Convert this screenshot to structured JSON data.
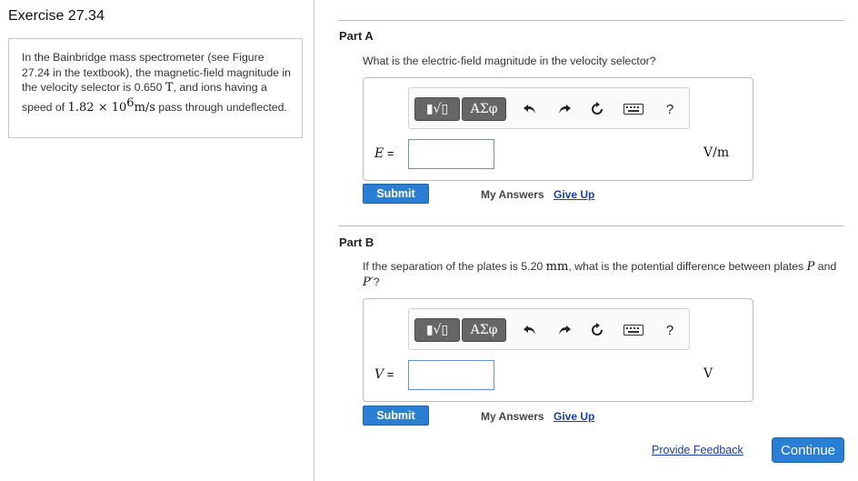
{
  "exercise": {
    "title": "Exercise 27.34",
    "problem": {
      "text_1": "In the Bainbridge mass spectrometer (see Figure 27.24 in the textbook), the magnetic-field magnitude in the velocity selector is 0.650 ",
      "field_unit": "T",
      "text_2": ", and ions having a speed of ",
      "speed_mantissa": "1.82",
      "times": "×",
      "speed_base": "10",
      "speed_exp": "6",
      "speed_unit": "m/s",
      "text_3": " pass through undeflected."
    }
  },
  "toolbar": {
    "templates_label": "▮√▯",
    "greek_label": "ΑΣφ",
    "help_label": "?"
  },
  "part_a": {
    "title": "Part A",
    "question": "What is the electric-field magnitude in the velocity selector?",
    "variable": "E",
    "equals": " =",
    "input_value": "",
    "unit": "V/m",
    "submit_label": "Submit",
    "my_answers_label": "My Answers",
    "give_up_label": "Give Up"
  },
  "part_b": {
    "title": "Part B",
    "question_1": "If the separation of the plates is 5.20 ",
    "sep_unit": "mm",
    "question_2": ", what is the potential difference between plates ",
    "plate_p": "P",
    "and": " and ",
    "plate_p_prime": "P′",
    "question_end": "?",
    "variable": "V",
    "equals": " =",
    "input_value": "",
    "unit": "V",
    "submit_label": "Submit",
    "my_answers_label": "My Answers",
    "give_up_label": "Give Up"
  },
  "footer": {
    "feedback_label": "Provide Feedback",
    "continue_label": "Continue"
  }
}
